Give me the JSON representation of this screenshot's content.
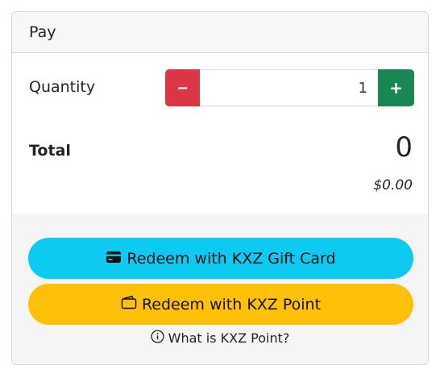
{
  "header": {
    "title": "Pay"
  },
  "quantity": {
    "label": "Quantity",
    "minus_label": "−",
    "plus_label": "+",
    "value": "1"
  },
  "total": {
    "label": "Total",
    "value": "0",
    "price": "$0.00"
  },
  "actions": {
    "gift_card_label": "Redeem with KXZ Gift Card",
    "point_label": "Redeem with KXZ Point",
    "help_label": "What is KXZ Point?"
  },
  "colors": {
    "danger": "#dc3545",
    "success": "#198754",
    "info": "#0dcaf0",
    "warning": "#ffc107"
  },
  "icons": {
    "gift_card": "credit-card-icon",
    "point": "wallet-icon",
    "help": "info-circle-icon"
  }
}
